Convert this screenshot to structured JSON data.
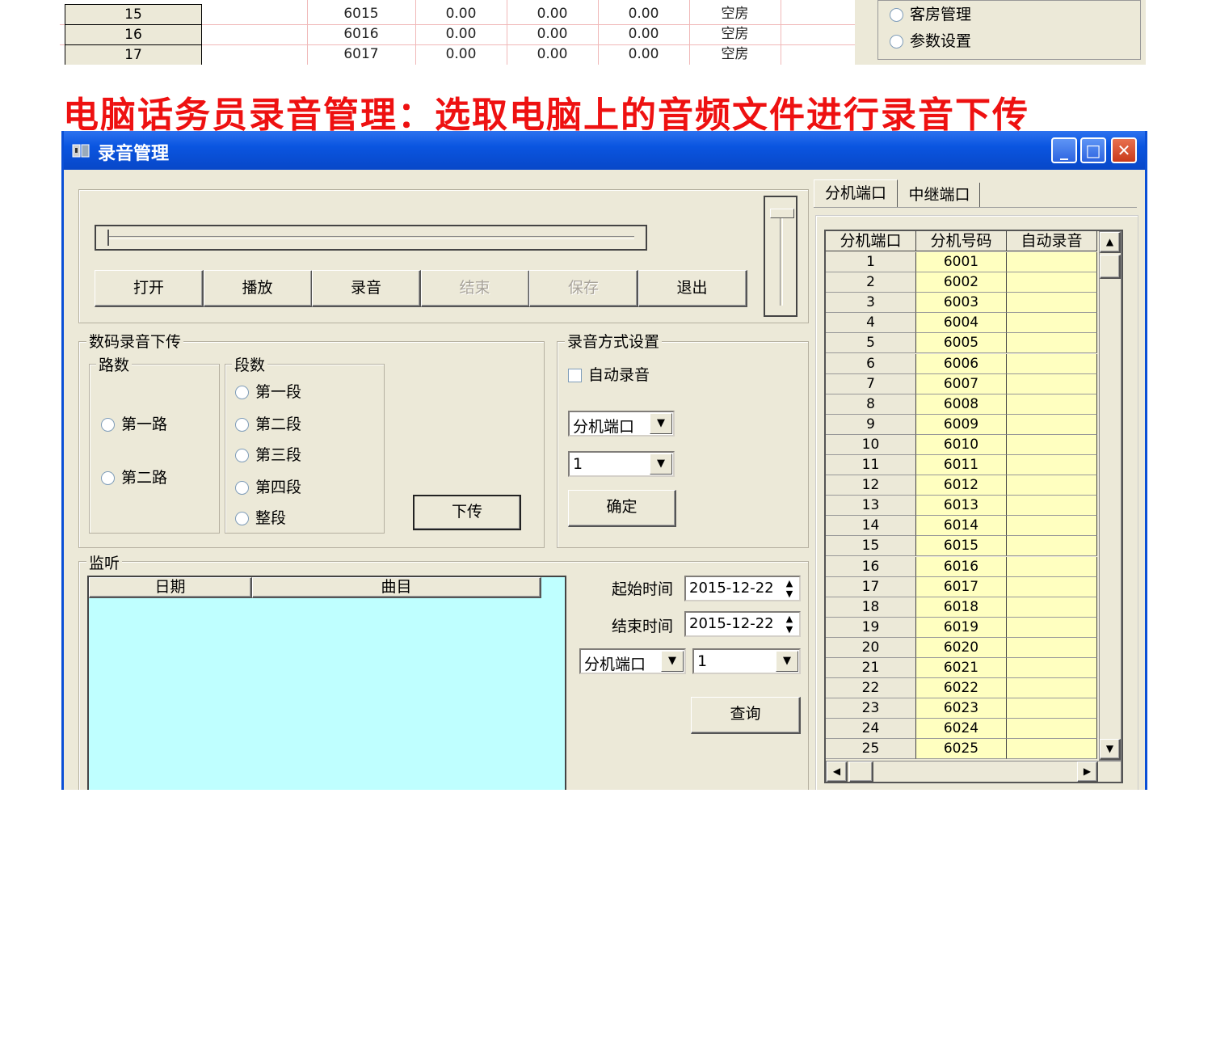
{
  "top_table": {
    "rows": [
      {
        "idx": "15",
        "ext": "6015",
        "v1": "0.00",
        "v2": "0.00",
        "v3": "0.00",
        "status": "空房"
      },
      {
        "idx": "16",
        "ext": "6016",
        "v1": "0.00",
        "v2": "0.00",
        "v3": "0.00",
        "status": "空房"
      },
      {
        "idx": "17",
        "ext": "6017",
        "v1": "0.00",
        "v2": "0.00",
        "v3": "0.00",
        "status": "空房"
      }
    ],
    "side_options": [
      "客房管理",
      "参数设置"
    ]
  },
  "caption": "电脑话务员录音管理：选取电脑上的音频文件进行录音下传",
  "window": {
    "title": "录音管理",
    "controls": {
      "minimize": "_",
      "maximize": "□",
      "close": "✕"
    },
    "icons": {
      "app": "recorder-icon"
    }
  },
  "player": {
    "buttons": [
      "打开",
      "播放",
      "录音",
      "结束",
      "保存",
      "退出"
    ],
    "disabled": [
      false,
      false,
      false,
      true,
      true,
      false
    ],
    "progress": 0.0
  },
  "upload_group": {
    "title": "数码录音下传",
    "lines_title": "路数",
    "lines": [
      "第一路",
      "第二路"
    ],
    "segments_title": "段数",
    "segments": [
      "第一段",
      "第二段",
      "第三段",
      "第四段",
      "整段"
    ],
    "upload_button": "下传"
  },
  "record_mode": {
    "title": "录音方式设置",
    "auto_record": "自动录音",
    "auto_record_checked": false,
    "port_select": "分机端口",
    "number_select": "1",
    "confirm_button": "确定"
  },
  "monitor": {
    "title": "监听",
    "columns": [
      "日期",
      "曲目"
    ],
    "start_label": "起始时间",
    "start_value": "2015-12-22",
    "end_label": "结束时间",
    "end_value": "2015-12-22",
    "port_select": "分机端口",
    "number_select": "1",
    "query_button": "查询"
  },
  "tabs": [
    "分机端口",
    "中继端口"
  ],
  "port_table": {
    "columns": [
      "分机端口",
      "分机号码",
      "自动录音"
    ],
    "rows": [
      [
        "1",
        "6001",
        ""
      ],
      [
        "2",
        "6002",
        ""
      ],
      [
        "3",
        "6003",
        ""
      ],
      [
        "4",
        "6004",
        ""
      ],
      [
        "5",
        "6005",
        ""
      ],
      [
        "6",
        "6006",
        ""
      ],
      [
        "7",
        "6007",
        ""
      ],
      [
        "8",
        "6008",
        ""
      ],
      [
        "9",
        "6009",
        ""
      ],
      [
        "10",
        "6010",
        ""
      ],
      [
        "11",
        "6011",
        ""
      ],
      [
        "12",
        "6012",
        ""
      ],
      [
        "13",
        "6013",
        ""
      ],
      [
        "14",
        "6014",
        ""
      ],
      [
        "15",
        "6015",
        ""
      ],
      [
        "16",
        "6016",
        ""
      ],
      [
        "17",
        "6017",
        ""
      ],
      [
        "18",
        "6018",
        ""
      ],
      [
        "19",
        "6019",
        ""
      ],
      [
        "20",
        "6020",
        ""
      ],
      [
        "21",
        "6021",
        ""
      ],
      [
        "22",
        "6022",
        ""
      ],
      [
        "23",
        "6023",
        ""
      ],
      [
        "24",
        "6024",
        ""
      ],
      [
        "25",
        "6025",
        ""
      ]
    ]
  },
  "colors": {
    "caption": "#ee1111",
    "titlebar": "#0a55e0",
    "list_bg": "#bfffff",
    "cell_bg": "#ffffc0"
  }
}
